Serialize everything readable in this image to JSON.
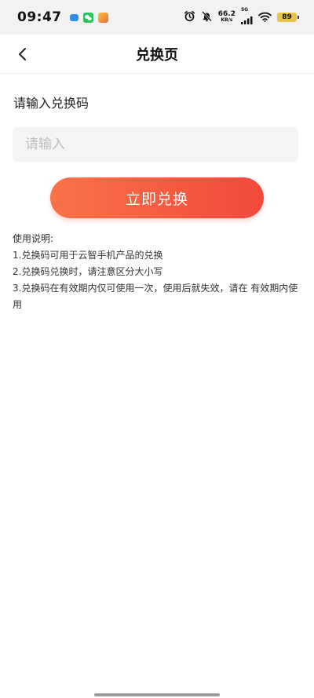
{
  "status_bar": {
    "time": "09:47",
    "net_speed_value": "66.2",
    "net_speed_unit": "KB/s",
    "network_type": "5G",
    "battery_level": "89",
    "icons": [
      "alarm-icon",
      "mute-icon",
      "signal-icon",
      "wifi-icon",
      "battery-icon"
    ],
    "app_icons": [
      "app-blue-icon",
      "wechat-icon",
      "app-orange-icon"
    ]
  },
  "nav": {
    "title": "兑换页",
    "back_icon": "chevron-left-icon"
  },
  "form": {
    "prompt": "请输入兑换码",
    "input_value": "",
    "input_placeholder": "请输入",
    "submit_label": "立即兑换"
  },
  "instructions": {
    "heading": "使用说明:",
    "items": [
      "1.兑换码可用于云智手机产品的兑换",
      "2.兑换码兑换时，请注意区分大小写",
      "3.兑换码在有效期内仅可使用一次，使用后就失效，请在 有效期内使用"
    ]
  },
  "colors": {
    "button_gradient_start": "#f87248",
    "button_gradient_end": "#f2493b",
    "input_background": "#f5f5f5",
    "status_bar_background": "#f2f2f2",
    "battery": "#e8c447"
  }
}
